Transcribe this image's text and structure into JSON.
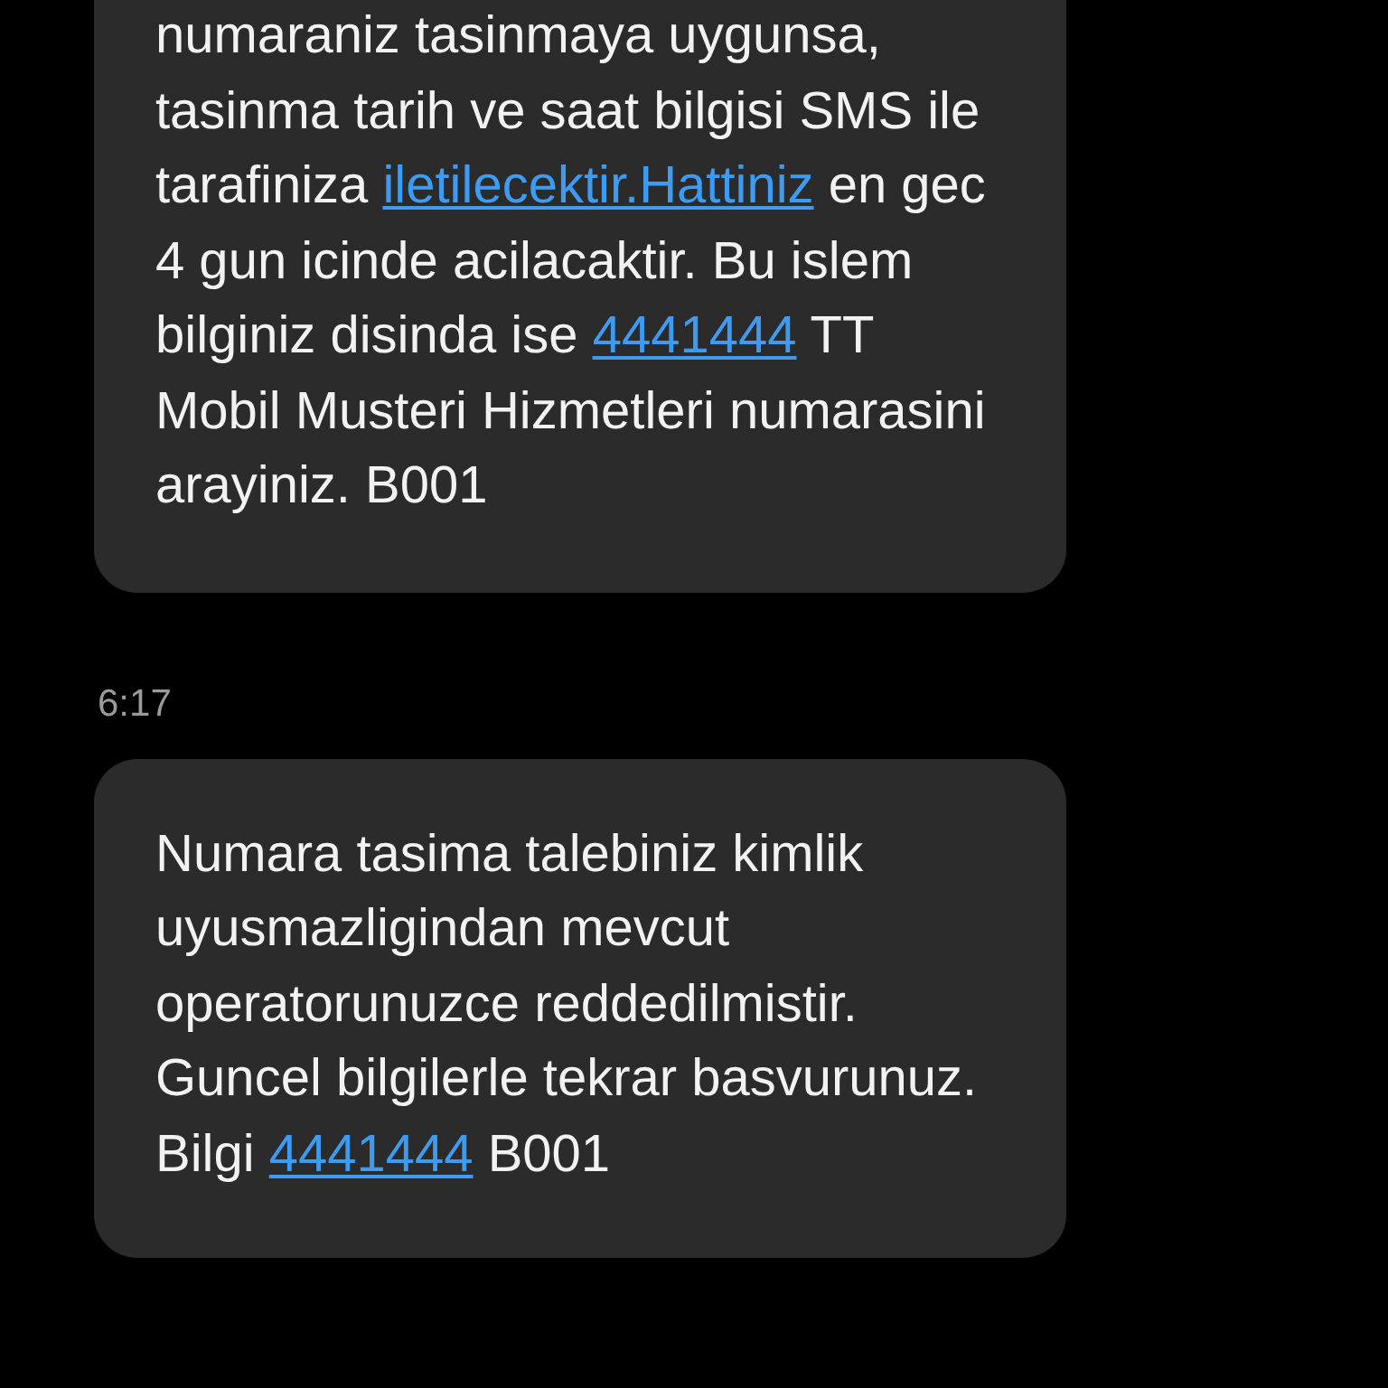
{
  "conversation": [
    {
      "kind": "message",
      "parts": [
        {
          "kind": "text",
          "text": "numaraniz tasinmaya uygunsa,\ntasinma tarih ve saat bilgisi SMS ile\ntarafiniza "
        },
        {
          "kind": "link",
          "text": "iletilecektir.Hattiniz"
        },
        {
          "kind": "text",
          "text": " en gec\n4 gun icinde acilacaktir. Bu islem\nbilginiz disinda ise "
        },
        {
          "kind": "link",
          "text": "4441444"
        },
        {
          "kind": "text",
          "text": " TT\nMobil Musteri Hizmetleri numarasini\narayiniz. B001"
        }
      ]
    },
    {
      "kind": "timestamp",
      "text": "6:17"
    },
    {
      "kind": "message",
      "parts": [
        {
          "kind": "text",
          "text": "Numara tasima talebiniz kimlik\nuyusmazligindan mevcut\noperatorunuzce reddedilmistir.\nGuncel bilgilerle tekrar basvurunuz.\nBilgi "
        },
        {
          "kind": "link",
          "text": "4441444"
        },
        {
          "kind": "text",
          "text": " B001"
        }
      ]
    }
  ]
}
